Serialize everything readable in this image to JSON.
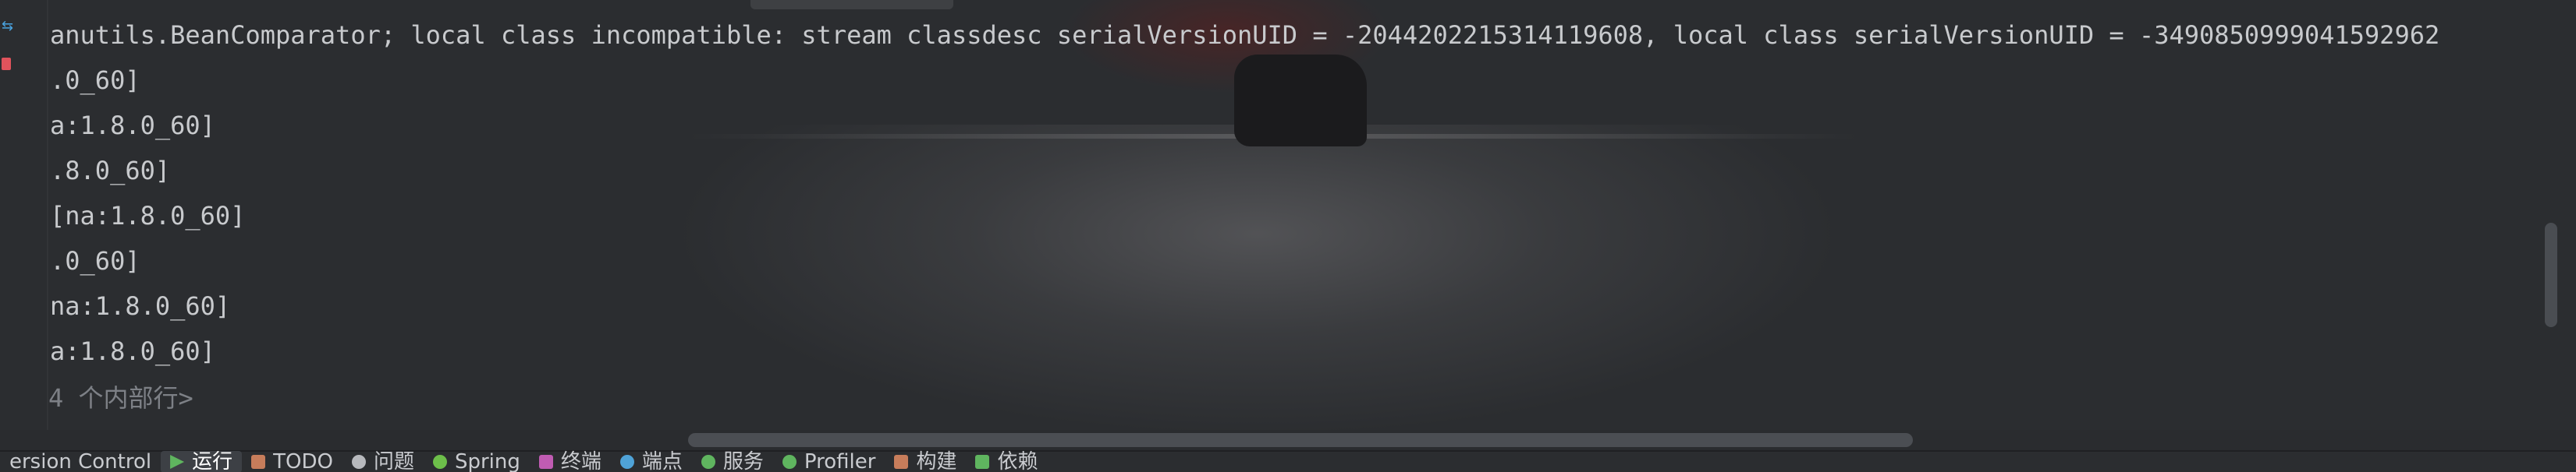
{
  "console": {
    "lines": [
      "anutils.BeanComparator; local class incompatible: stream classdesc serialVersionUID = -2044202215314119608, local class serialVersionUID = -3490850999041592962",
      ".0_60]",
      "a:1.8.0_60]",
      ".8.0_60]",
      "[na:1.8.0_60]",
      ".0_60]",
      "na:1.8.0_60]",
      "a:1.8.0_60]"
    ],
    "fold": {
      "icon": "plus-icon",
      "symbol": "+",
      "text": "4 个内部行>"
    }
  },
  "toolbar": {
    "items": [
      {
        "label": "ersion Control",
        "icon": "version-control-icon",
        "color": "#aeb1b6"
      },
      {
        "label": "运行",
        "icon": "run-icon",
        "color": "#5fb55f",
        "active": true
      },
      {
        "label": "TODO",
        "icon": "todo-icon",
        "color": "#c77d5b"
      },
      {
        "label": "问题",
        "icon": "problems-icon",
        "color": "#b7b9bd"
      },
      {
        "label": "Spring",
        "icon": "spring-icon",
        "color": "#6dbf4a"
      },
      {
        "label": "终端",
        "icon": "terminal-icon",
        "color": "#c05cb3"
      },
      {
        "label": "端点",
        "icon": "endpoints-icon",
        "color": "#4fa3d8"
      },
      {
        "label": "服务",
        "icon": "services-icon",
        "color": "#5fb55f"
      },
      {
        "label": "Profiler",
        "icon": "profiler-icon",
        "color": "#5fb55f"
      },
      {
        "label": "构建",
        "icon": "build-icon",
        "color": "#c77d5b"
      },
      {
        "label": "依赖",
        "icon": "dependencies-icon",
        "color": "#5fb55f"
      }
    ]
  }
}
